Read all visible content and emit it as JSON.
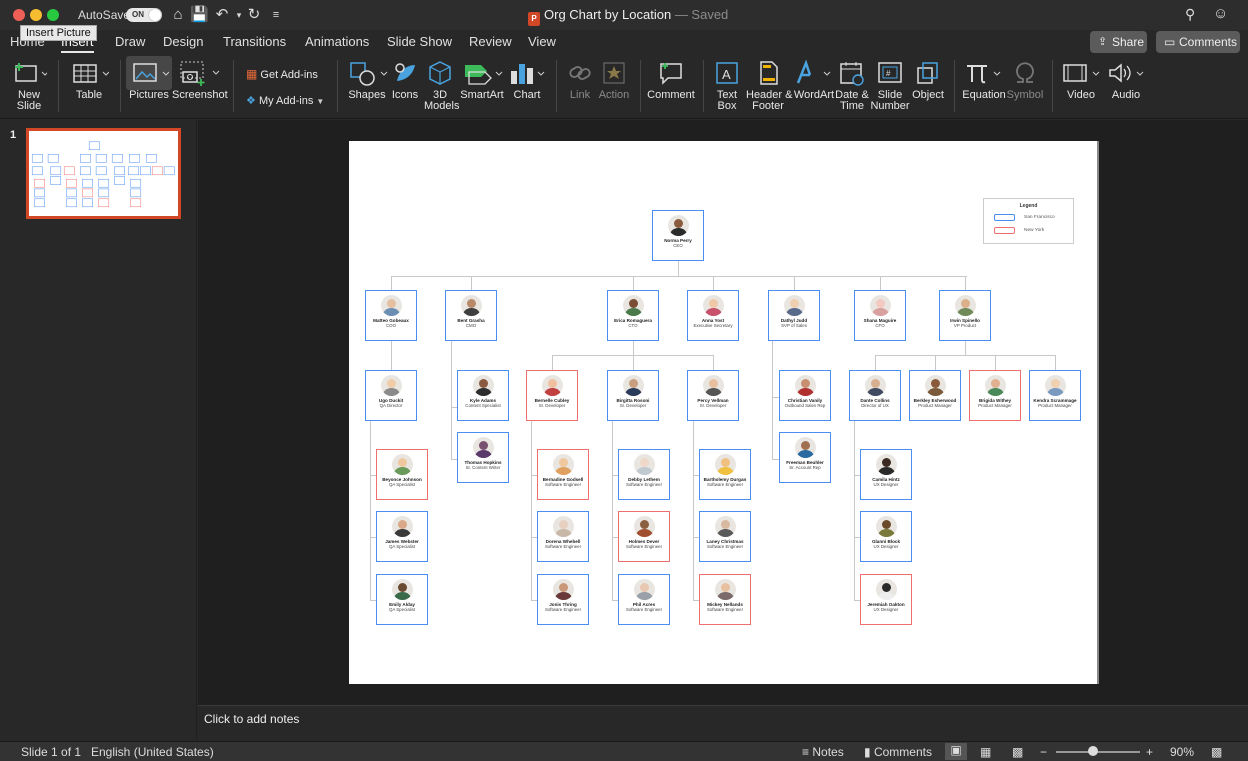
{
  "window": {
    "autosave_label": "AutoSave",
    "autosave_state": "ON",
    "doc_title": "Org Chart by Location",
    "doc_status": "— Saved",
    "tooltip": "Insert Picture"
  },
  "tabs": [
    {
      "label": "Home"
    },
    {
      "label": "Insert"
    },
    {
      "label": "Draw"
    },
    {
      "label": "Design"
    },
    {
      "label": "Transitions"
    },
    {
      "label": "Animations"
    },
    {
      "label": "Slide Show"
    },
    {
      "label": "Review"
    },
    {
      "label": "View"
    }
  ],
  "header_buttons": {
    "share": "Share",
    "comments": "Comments"
  },
  "ribbon": {
    "new_slide": "New\nSlide",
    "table": "Table",
    "pictures": "Pictures",
    "screenshot": "Screenshot",
    "get_addins": "Get Add-ins",
    "my_addins": "My Add-ins",
    "shapes": "Shapes",
    "icons": "Icons",
    "models3d": "3D\nModels",
    "smartart": "SmartArt",
    "chart": "Chart",
    "link": "Link",
    "action": "Action",
    "comment": "Comment",
    "textbox": "Text\nBox",
    "header_footer": "Header &\nFooter",
    "wordart": "WordArt",
    "datetime": "Date &\nTime",
    "slide_number": "Slide\nNumber",
    "object": "Object",
    "equation": "Equation",
    "symbol": "Symbol",
    "video": "Video",
    "audio": "Audio"
  },
  "slide_panel": {
    "number": "1"
  },
  "notes_placeholder": "Click to add notes",
  "status": {
    "slide": "Slide 1 of 1",
    "language": "English (United States)",
    "notes": "Notes",
    "comments": "Comments",
    "zoom": "90%"
  },
  "legend": {
    "title": "Legend",
    "items": [
      {
        "label": "San Francisco",
        "color": "#4a8ef2"
      },
      {
        "label": "New York",
        "color": "#ef6f6f"
      }
    ]
  },
  "people": [
    {
      "name": "Norma Perry",
      "title": "CEO",
      "loc": "sf"
    },
    {
      "name": "Matteo Gobeaux",
      "title": "COO",
      "loc": "sf"
    },
    {
      "name": "Bent Grasha",
      "title": "CMO",
      "loc": "sf"
    },
    {
      "name": "Erica Romaguera",
      "title": "CTO",
      "loc": "sf"
    },
    {
      "name": "Anna Yost",
      "title": "Executive Secretary",
      "loc": "sf"
    },
    {
      "name": "Dathyl Judd",
      "title": "SVP of Sales",
      "loc": "sf"
    },
    {
      "name": "Shana Maguire",
      "title": "CFO",
      "loc": "sf"
    },
    {
      "name": "Irwin Spinello",
      "title": "VP Product",
      "loc": "sf"
    },
    {
      "name": "Ugo Duckit",
      "title": "QA Director",
      "loc": "sf"
    },
    {
      "name": "Kyle Adams",
      "title": "Content Specialist",
      "loc": "sf"
    },
    {
      "name": "Bernelle Cubley",
      "title": "Sr. Developer",
      "loc": "ny"
    },
    {
      "name": "Birgitta Rosoni",
      "title": "Sr. Developer",
      "loc": "sf"
    },
    {
      "name": "Percy Vellman",
      "title": "Sr. Developer",
      "loc": "sf"
    },
    {
      "name": "Christian Vanily",
      "title": "Outbound Sales Rep",
      "loc": "sf"
    },
    {
      "name": "Dante Collins",
      "title": "Director of UX",
      "loc": "sf"
    },
    {
      "name": "Berkley Esherwood",
      "title": "Product Manager",
      "loc": "sf"
    },
    {
      "name": "Brigida Withey",
      "title": "Product Manager",
      "loc": "ny"
    },
    {
      "name": "Kendra Scrammage",
      "title": "Product Manager",
      "loc": "sf"
    },
    {
      "name": "Thomas Hopkins",
      "title": "Sr. Content Writer",
      "loc": "sf"
    },
    {
      "name": "Freeman Beuhler",
      "title": "Sr. Account Rep",
      "loc": "sf"
    },
    {
      "name": "Beyonce Johnson",
      "title": "QA Specialist",
      "loc": "ny"
    },
    {
      "name": "James Webster",
      "title": "QA Specialist",
      "loc": "sf"
    },
    {
      "name": "Emily Alday",
      "title": "QA Specialist",
      "loc": "sf"
    },
    {
      "name": "Bernadine Godsell",
      "title": "Software Engineer",
      "loc": "ny"
    },
    {
      "name": "Dorena Whebell",
      "title": "Software Engineer",
      "loc": "sf"
    },
    {
      "name": "Jonis Thring",
      "title": "Software Engineer",
      "loc": "sf"
    },
    {
      "name": "Debby Lethem",
      "title": "Software Engineer",
      "loc": "sf"
    },
    {
      "name": "Holmes Dever",
      "title": "Software Engineer",
      "loc": "ny"
    },
    {
      "name": "Phil Acres",
      "title": "Software Engineer",
      "loc": "sf"
    },
    {
      "name": "Bartholemy Durgan",
      "title": "Software Engineer",
      "loc": "sf"
    },
    {
      "name": "Laney Christmas",
      "title": "Software Engineer",
      "loc": "sf"
    },
    {
      "name": "Mickey Nellands",
      "title": "Software Engineer",
      "loc": "ny"
    },
    {
      "name": "Camila Hintz",
      "title": "UX Designer",
      "loc": "sf"
    },
    {
      "name": "Glanni Block",
      "title": "UX Designer",
      "loc": "sf"
    },
    {
      "name": "Jeremiah Oakton",
      "title": "UX Designer",
      "loc": "ny"
    }
  ]
}
